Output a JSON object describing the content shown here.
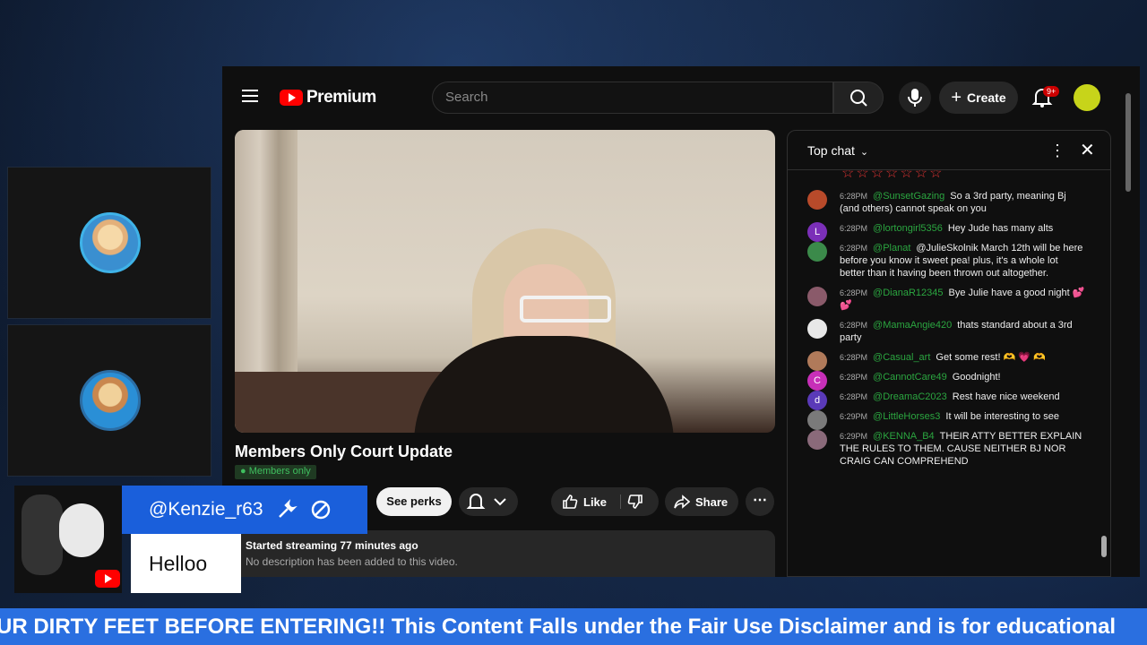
{
  "youtube": {
    "logo_text": "Premium",
    "search_placeholder": "Search",
    "create_label": "Create",
    "notif_badge": "9+"
  },
  "video": {
    "title": "Members Only Court Update",
    "members_badge": "Members only",
    "perks_label": "See perks",
    "like_label": "Like",
    "share_label": "Share",
    "desc_line1": "Started streaming 77 minutes ago",
    "desc_line2": "No description has been added to this video."
  },
  "chat": {
    "title": "Top chat",
    "messages": [
      {
        "time": "6:28PM",
        "author": "@SunsetGazing",
        "text": "So a 3rd party, meaning Bj (and others) cannot speak on you",
        "avatar": "",
        "avatar_color": "#b84a2a"
      },
      {
        "time": "6:28PM",
        "author": "@lortongirl5356",
        "text": "Hey Jude has many alts",
        "avatar": "L",
        "avatar_color": "#7b2fb8"
      },
      {
        "time": "6:28PM",
        "author": "@Planat",
        "text": "@JulieSkolnik March 12th will be here before you know it sweet pea! plus, it's a whole lot better than it having been thrown out altogether.",
        "avatar": "",
        "avatar_color": "#3b8a4a"
      },
      {
        "time": "6:28PM",
        "author": "@DianaR12345",
        "text": "Bye Julie have a good night 💕 💕",
        "avatar": "",
        "avatar_color": "#8a5a6a"
      },
      {
        "time": "6:28PM",
        "author": "@MamaAngie420",
        "text": "thats standard about a 3rd party",
        "avatar": "",
        "avatar_color": "#e8e8e8"
      },
      {
        "time": "6:28PM",
        "author": "@Casual_art",
        "text": "Get some rest! 🫶 💗 🫶",
        "avatar": "",
        "avatar_color": "#b07a5a"
      },
      {
        "time": "6:28PM",
        "author": "@CannotCare49",
        "text": "Goodnight!",
        "avatar": "C",
        "avatar_color": "#c72fb8"
      },
      {
        "time": "6:28PM",
        "author": "@DreamaC2023",
        "text": "Rest have nice weekend",
        "avatar": "d",
        "avatar_color": "#5a3ab8"
      },
      {
        "time": "6:29PM",
        "author": "@LittleHorses3",
        "text": "It will be interesting to see",
        "avatar": "",
        "avatar_color": "#7a7a7a"
      },
      {
        "time": "6:29PM",
        "author": "@KENNA_B4",
        "text": "THEIR ATTY BETTER EXPLAIN THE RULES TO THEM. CAUSE NEITHER BJ NOR CRAIG CAN COMPREHEND",
        "avatar": "",
        "avatar_color": "#8a6a7a"
      }
    ]
  },
  "overlay": {
    "username": "@Kenzie_r63",
    "message": "Helloo"
  },
  "ticker": {
    "text": "UR DIRTY FEET BEFORE ENTERING!! This Content Falls under the Fair Use Disclaimer and is for educational"
  }
}
